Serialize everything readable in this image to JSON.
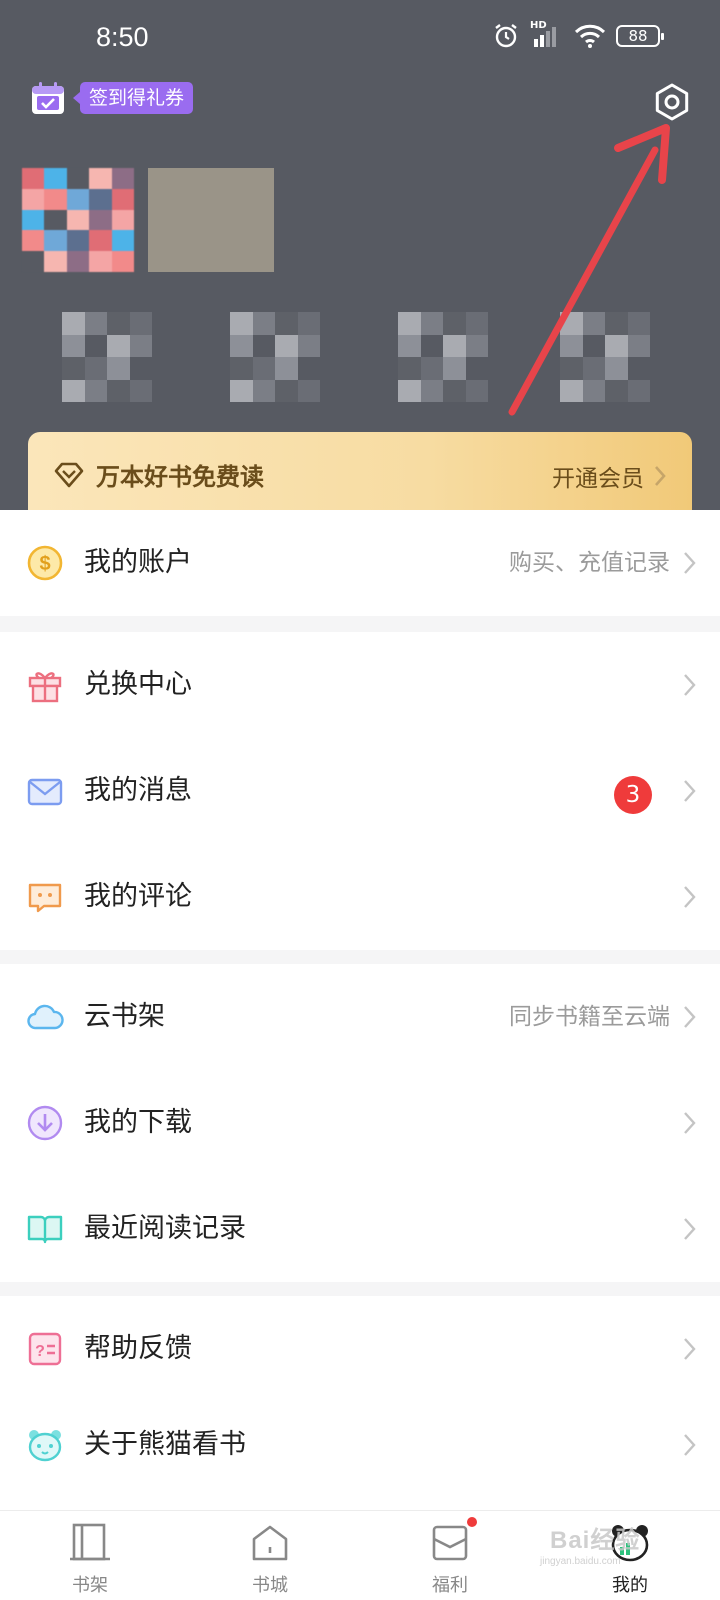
{
  "status_bar": {
    "time": "8:50",
    "battery": "88",
    "network": "HD"
  },
  "header": {
    "signin_label": "签到得礼券",
    "vip": {
      "title": "万本好书免费读",
      "action": "开通会员"
    }
  },
  "groups": [
    {
      "items": [
        {
          "label": "我的账户",
          "right": "购买、充值记录",
          "icon": "coin-icon"
        }
      ]
    },
    {
      "items": [
        {
          "label": "兑换中心",
          "icon": "gift-icon"
        },
        {
          "label": "我的消息",
          "badge": "3",
          "icon": "mail-icon"
        },
        {
          "label": "我的评论",
          "icon": "comment-icon"
        }
      ]
    },
    {
      "items": [
        {
          "label": "云书架",
          "right": "同步书籍至云端",
          "icon": "cloud-icon"
        },
        {
          "label": "我的下载",
          "icon": "download-icon"
        },
        {
          "label": "最近阅读记录",
          "icon": "book-open-icon"
        }
      ]
    },
    {
      "items": [
        {
          "label": "帮助反馈",
          "icon": "help-icon"
        },
        {
          "label": "关于熊猫看书",
          "icon": "panda-icon"
        }
      ]
    }
  ],
  "tabbar": {
    "active": "我的",
    "tabs": [
      {
        "label": "书架",
        "icon": "bookshelf-icon"
      },
      {
        "label": "书城",
        "icon": "home-icon"
      },
      {
        "label": "福利",
        "icon": "welfare-icon"
      },
      {
        "label": "我的",
        "icon": "panda-tab-icon"
      }
    ]
  },
  "watermark": {
    "text": "Bai经验",
    "sub": "jingyan.baidu.com"
  },
  "colors": {
    "header_bg": "#575a62",
    "accent_purple": "#9a6cf0",
    "badge_red": "#ef3b3b",
    "vip_gold": "#f7dca2",
    "annotation_arrow": "#e8444a"
  }
}
